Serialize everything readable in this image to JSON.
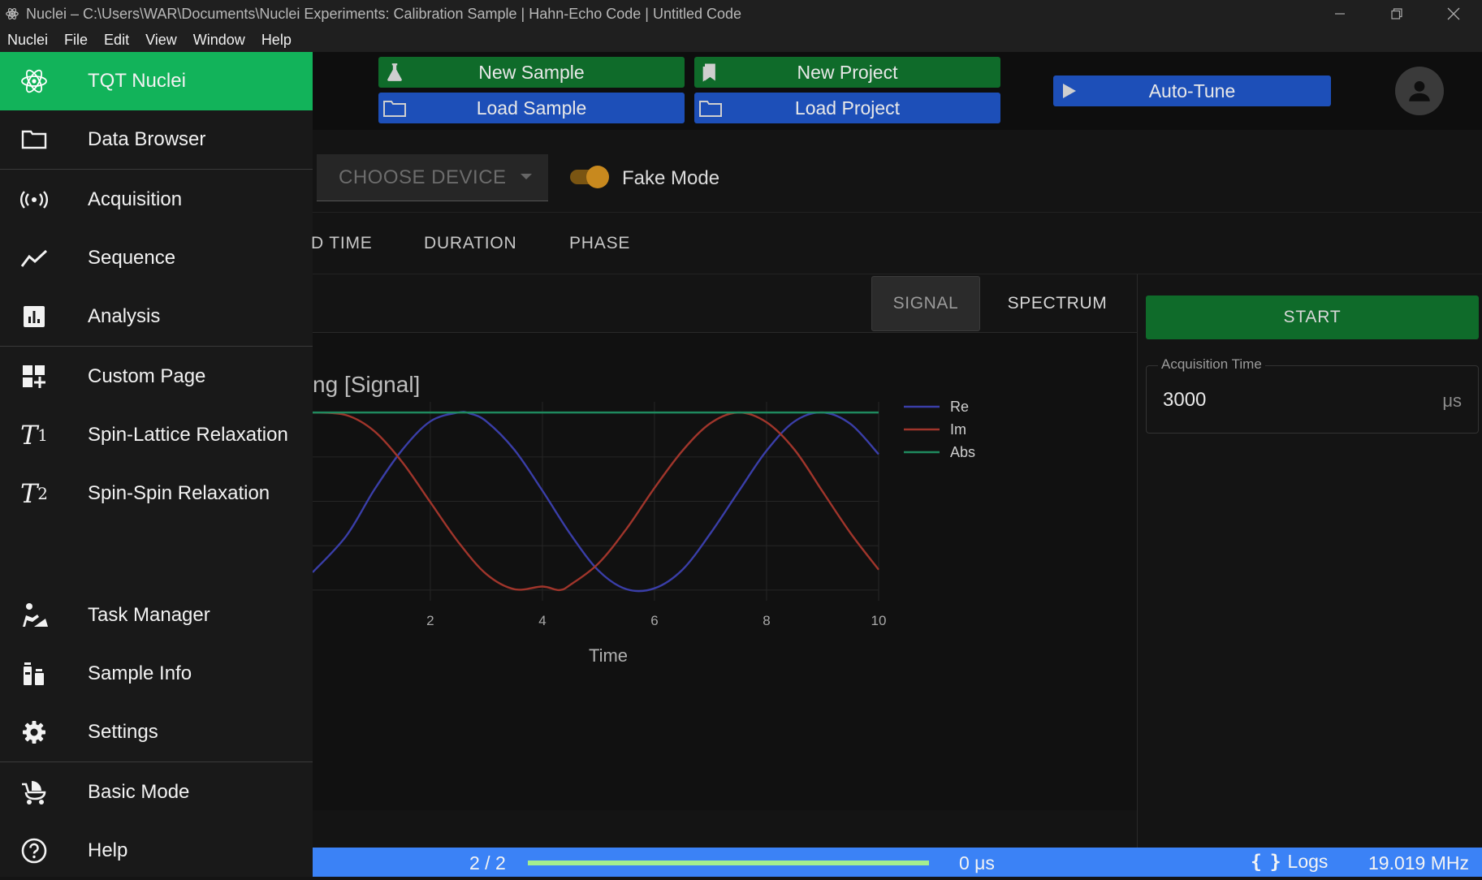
{
  "window": {
    "title": "Nuclei – C:\\Users\\WAR\\Documents\\Nuclei Experiments: Calibration Sample | Hahn-Echo Code | Untitled Code"
  },
  "menu": [
    "Nuclei",
    "File",
    "Edit",
    "View",
    "Window",
    "Help"
  ],
  "toolbar": {
    "new_sample": "New Sample",
    "load_sample": "Load Sample",
    "new_project": "New Project",
    "load_project": "Load Project",
    "auto_tune": "Auto-Tune"
  },
  "sidebar": {
    "items": [
      {
        "label": "TQT Nuclei",
        "icon": "atom-icon",
        "active": true
      },
      {
        "label": "Data Browser",
        "icon": "folder-icon"
      },
      {
        "label": "Acquisition",
        "icon": "broadcast-icon"
      },
      {
        "label": "Sequence",
        "icon": "trend-icon"
      },
      {
        "label": "Analysis",
        "icon": "chart-icon"
      },
      {
        "label": "Custom Page",
        "icon": "dashboard-add-icon"
      },
      {
        "label": "Spin-Lattice Relaxation",
        "icon": "t1-icon"
      },
      {
        "label": "Spin-Spin Relaxation",
        "icon": "t2-icon"
      },
      {
        "label": "Task Manager",
        "icon": "task-icon"
      },
      {
        "label": "Sample Info",
        "icon": "sample-icon"
      },
      {
        "label": "Settings",
        "icon": "gear-icon"
      },
      {
        "label": "Basic Mode",
        "icon": "stroller-icon"
      },
      {
        "label": "Help",
        "icon": "help-icon"
      }
    ],
    "t1_glyph": "T",
    "t1_sub": "1",
    "t2_glyph": "T",
    "t2_sub": "2"
  },
  "device": {
    "placeholder": "CHOOSE DEVICE",
    "fake_mode_label": "Fake Mode",
    "fake_mode_on": true
  },
  "param_tabs": [
    "D TIME",
    "DURATION",
    "PHASE"
  ],
  "plot": {
    "tabs": [
      "SIGNAL",
      "SPECTRUM"
    ],
    "selected_tab": "SIGNAL",
    "title": "ng [Signal]"
  },
  "controls": {
    "start_label": "START",
    "acq_time_label": "Acquisition Time",
    "acq_time_value": "3000",
    "acq_time_unit": "μs"
  },
  "status": {
    "count": "2 / 2",
    "progress": 1.0,
    "time": "0 μs",
    "logs_label": "Logs",
    "logs_glyph": "{ }",
    "frequency": "19.019 MHz"
  },
  "chart_data": {
    "type": "line",
    "xlabel": "Time",
    "xlim": [
      -0.1,
      10.0
    ],
    "ylim": [
      -1.12,
      1.12
    ],
    "xticks": [
      2,
      4,
      6,
      8,
      10
    ],
    "legend_position": "right",
    "series": [
      {
        "name": "Re",
        "color": "#3a3ea8",
        "x": [
          -0.1,
          0.5,
          1.0,
          1.5,
          2.0,
          2.5,
          2.7,
          3.0,
          3.5,
          4.0,
          4.5,
          5.0,
          5.5,
          6.0,
          6.5,
          7.0,
          7.5,
          8.0,
          8.5,
          9.0,
          9.5,
          10.0
        ],
        "y": [
          -0.8,
          -0.39,
          0.13,
          0.58,
          0.9,
          1.0,
          0.99,
          0.9,
          0.58,
          0.12,
          -0.37,
          -0.78,
          -0.99,
          -0.98,
          -0.77,
          -0.36,
          0.11,
          0.57,
          0.9,
          1.0,
          0.87,
          0.53
        ]
      },
      {
        "name": "Im",
        "color": "#a0352b",
        "x": [
          -0.1,
          0.5,
          1.0,
          1.5,
          2.0,
          2.5,
          3.0,
          3.5,
          4.0,
          4.3,
          4.5,
          5.0,
          5.5,
          6.0,
          6.5,
          7.0,
          7.5,
          8.0,
          8.5,
          9.0,
          9.5,
          10.0
        ],
        "y": [
          1.0,
          0.97,
          0.79,
          0.44,
          -0.01,
          -0.46,
          -0.82,
          -0.99,
          -0.96,
          -1.0,
          -0.94,
          -0.7,
          -0.31,
          0.15,
          0.57,
          0.88,
          1.0,
          0.89,
          0.58,
          0.11,
          -0.36,
          -0.77
        ]
      },
      {
        "name": "Abs",
        "color": "#1f8a5f",
        "x": [
          -0.1,
          10.0
        ],
        "y": [
          1.0,
          1.0
        ]
      }
    ]
  }
}
